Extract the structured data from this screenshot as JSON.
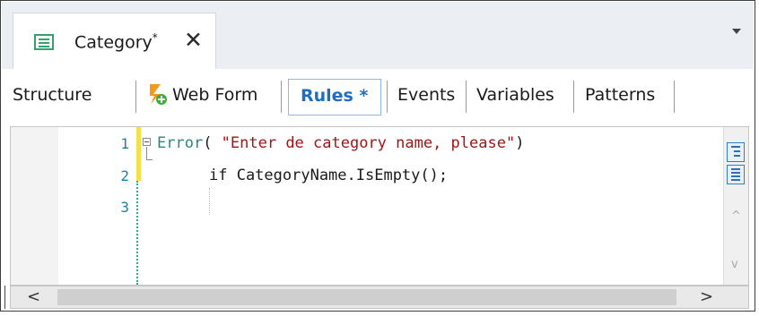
{
  "document_tab": {
    "title": "Category",
    "modified_marker": "*",
    "close_symbol": "✕"
  },
  "section_tabs": [
    {
      "label": "Structure"
    },
    {
      "label": "Web Form"
    },
    {
      "label": "Rules *",
      "selected": true
    },
    {
      "label": "Events"
    },
    {
      "label": "Variables"
    },
    {
      "label": "Patterns"
    }
  ],
  "editor": {
    "line_numbers": [
      "1",
      "2",
      "3"
    ],
    "lines": [
      {
        "kw": "Error",
        "p1": "( ",
        "str": "\"Enter de category name, please\"",
        "p2": ")"
      },
      {
        "text": "if CategoryName.IsEmpty();"
      },
      {
        "text": ""
      }
    ]
  },
  "scroll": {
    "left_arrow": "<",
    "right_arrow": ">",
    "up_chevron": "^",
    "down_chevron": "v"
  },
  "colors": {
    "accent": "#1f6fc0",
    "keyword": "#2a8a7c",
    "string": "#a31515",
    "line_number": "#1b7fa6"
  }
}
